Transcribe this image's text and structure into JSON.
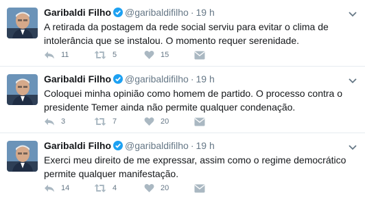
{
  "tweets": [
    {
      "name": "Garibaldi Filho",
      "handle": "@garibaldifilho",
      "separator": "·",
      "time": "19 h",
      "text": "A retirada da postagem da rede social serviu para evitar o clima de intolerância que se instalou. O momento requer serenidade.",
      "replies": "11",
      "retweets": "5",
      "likes": "15"
    },
    {
      "name": "Garibaldi Filho",
      "handle": "@garibaldifilho",
      "separator": "·",
      "time": "19 h",
      "text": "Coloquei minha opinião como homem de partido. O processo contra o presidente Temer ainda não permite qualquer condenação.",
      "replies": "3",
      "retweets": "7",
      "likes": "20"
    },
    {
      "name": "Garibaldi Filho",
      "handle": "@garibaldifilho",
      "separator": "·",
      "time": "19 h",
      "text": "Exerci meu direito de me expressar, assim como o regime democrático permite qualquer manifestação.",
      "replies": "14",
      "retweets": "4",
      "likes": "20"
    }
  ],
  "icons": {
    "reply": "reply-icon",
    "retweet": "retweet-icon",
    "like": "heart-icon",
    "dm": "direct-message-icon",
    "verified": "verified-badge-icon",
    "more": "chevron-down-icon"
  },
  "colors": {
    "text": "#14171a",
    "secondary": "#657786",
    "icon": "#aab8c2",
    "verified": "#1da1f2",
    "divider": "#e6ecf0"
  }
}
